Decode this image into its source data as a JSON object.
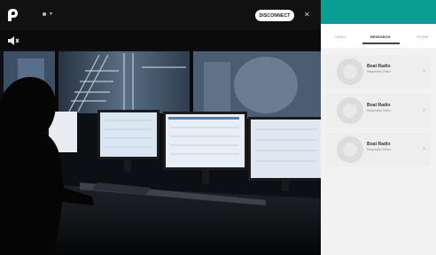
{
  "header": {
    "brand_color": "#0a9d93",
    "logo_icon": "brand-logo-icon",
    "cta_label": "DISCONNECT",
    "close_icon": "close-icon",
    "menu_icon": "chevron-down-icon"
  },
  "player": {
    "sound_icon": "speaker-icon"
  },
  "sidebar": {
    "tabs": [
      {
        "label": "VIDEO"
      },
      {
        "label": "RESEARCH"
      },
      {
        "label": "STORE"
      }
    ],
    "active_tab": 1,
    "cards": [
      {
        "title": "Boat Radio",
        "subtitle": "Requested Video",
        "icon": "chevron-right-icon"
      },
      {
        "title": "Boat Radio",
        "subtitle": "Requested Video",
        "icon": "chevron-right-icon"
      },
      {
        "title": "Boat Radio",
        "subtitle": "Requested Video",
        "icon": "chevron-right-icon"
      }
    ]
  }
}
